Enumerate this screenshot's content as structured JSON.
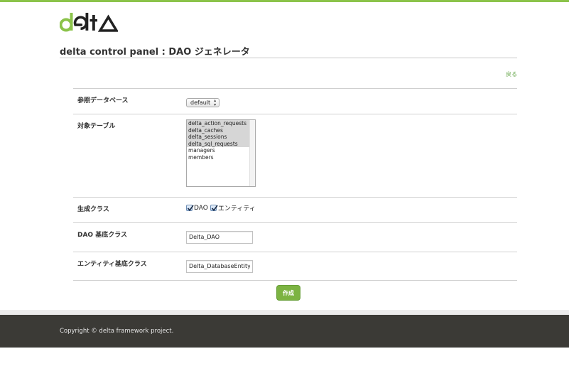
{
  "brand": {
    "logo_text": "delta",
    "accent_color": "#8bc34a"
  },
  "header": {
    "title": "delta control panel : DAO ジェネレータ",
    "back_link": "戻る"
  },
  "form": {
    "database": {
      "label": "参照データベース",
      "selected": "default"
    },
    "tables": {
      "label": "対象テーブル",
      "options": [
        {
          "name": "delta_action_requests",
          "selected": true
        },
        {
          "name": "delta_caches",
          "selected": true
        },
        {
          "name": "delta_sessions",
          "selected": true
        },
        {
          "name": "delta_sql_requests",
          "selected": true
        },
        {
          "name": "managers",
          "selected": false
        },
        {
          "name": "members",
          "selected": false
        }
      ]
    },
    "generate_classes": {
      "label": "生成クラス",
      "options": [
        {
          "label": "DAO",
          "checked": true
        },
        {
          "label": "エンティティ",
          "checked": true
        }
      ]
    },
    "dao_base_class": {
      "label": "DAO 基底クラス",
      "value": "Delta_DAO"
    },
    "entity_base_class": {
      "label": "エンティティ基底クラス",
      "value": "Delta_DatabaseEntity"
    },
    "submit_label": "作成"
  },
  "footer": {
    "copyright": "Copyright © delta framework project."
  }
}
